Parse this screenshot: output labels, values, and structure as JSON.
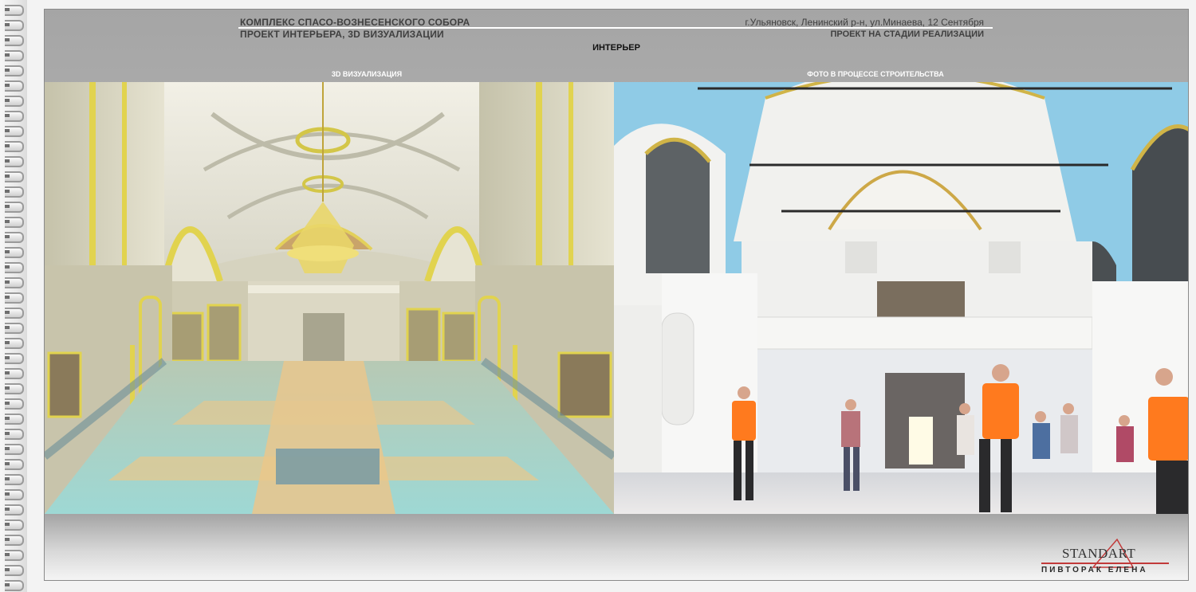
{
  "header": {
    "title_line1": "КОМПЛЕКС СПАСО-ВОЗНЕСЕНСКОГО СОБОРА",
    "title_line2": "ПРОЕКТ ИНТЕРЬЕРА, 3D ВИЗУАЛИЗАЦИИ",
    "location": "г.Ульяновск, Ленинский р-н, ул.Минаева, 12 Сентября",
    "stage": "ПРОЕКТ НА СТАДИИ РЕАЛИЗАЦИИ"
  },
  "section_title": "ИНТЕРЬЕР",
  "panels": {
    "left_label": "3D ВИЗУАЛИЗАЦИЯ",
    "right_label": "ФОТО В ПРОЦЕССЕ СТРОИТЕЛЬСТВА"
  },
  "logo": {
    "brand": "STANDART",
    "author": "ПИВТОРАК ЕЛЕНА"
  },
  "colors": {
    "accent_red": "#c23a3a",
    "gold": "#e5d35a",
    "sky_blue": "#7fc6e4"
  }
}
